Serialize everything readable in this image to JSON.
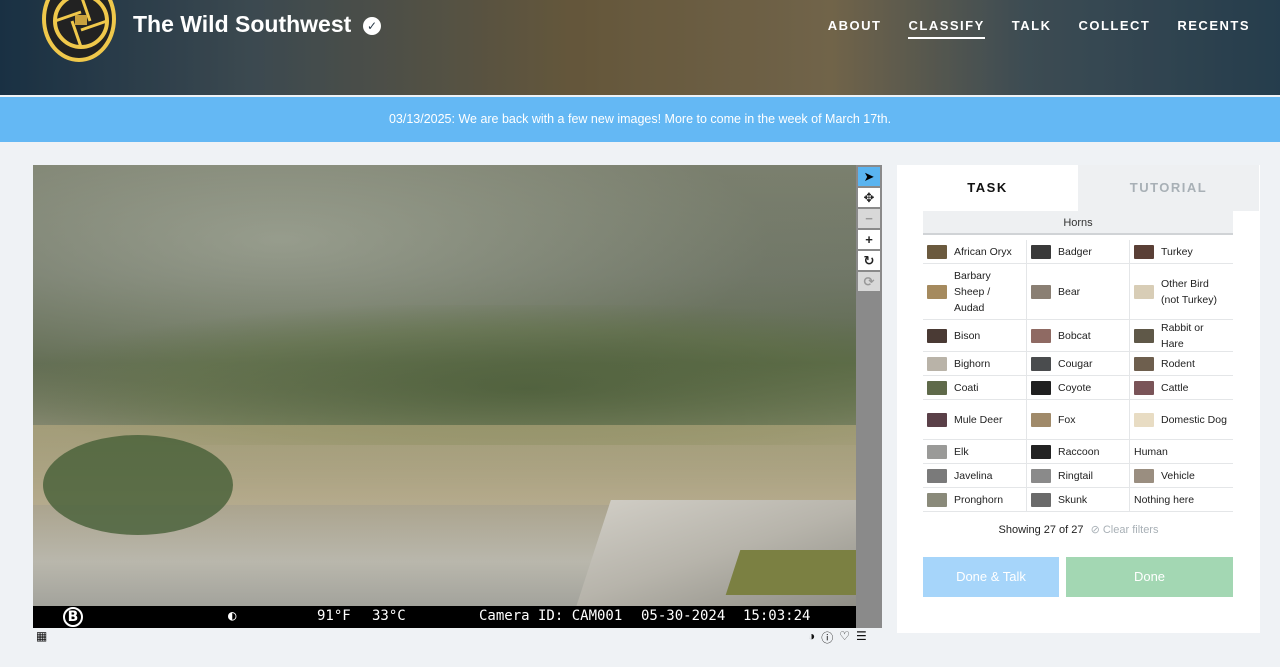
{
  "header": {
    "title": "The Wild Southwest",
    "nav": [
      "ABOUT",
      "CLASSIFY",
      "TALK",
      "COLLECT",
      "RECENTS"
    ],
    "active_nav": "CLASSIFY"
  },
  "banner": "03/13/2025: We are back with a few new images! More to come in the week of March 17th.",
  "image_info": {
    "brand_mark": "B",
    "temp_f": "91°F",
    "temp_c": "33°C",
    "camera": "Camera ID: CAM001",
    "date": "05-30-2024",
    "time": "15:03:24"
  },
  "tabs": {
    "task": "TASK",
    "tutorial": "TUTORIAL"
  },
  "filter_label": "Horns",
  "choices": [
    [
      {
        "label": "African Oryx",
        "color": "#6b5a3e"
      },
      {
        "label": "Badger",
        "color": "#3a3a3a"
      },
      {
        "label": "Turkey",
        "color": "#5a3f36"
      }
    ],
    [
      {
        "label": "Barbary Sheep / Audad",
        "color": "#a58a5e"
      },
      {
        "label": "Bear",
        "color": "#8a7f73"
      },
      {
        "label": "Other Bird (not Turkey)",
        "color": "#d8cdb6"
      }
    ],
    [
      {
        "label": "Bison",
        "color": "#4a3a34"
      },
      {
        "label": "Bobcat",
        "color": "#8f6a63"
      },
      {
        "label": "Rabbit or Hare",
        "color": "#5f5848"
      }
    ],
    [
      {
        "label": "Bighorn",
        "color": "#b9b3a8"
      },
      {
        "label": "Cougar",
        "color": "#4a4c4e"
      },
      {
        "label": "Rodent",
        "color": "#6e5f4e"
      }
    ],
    [
      {
        "label": "Coati",
        "color": "#5f6a4a"
      },
      {
        "label": "Coyote",
        "color": "#1f1f1f"
      },
      {
        "label": "Cattle",
        "color": "#7a5458"
      }
    ],
    [
      {
        "label": "Mule Deer",
        "color": "#5a4048"
      },
      {
        "label": "Fox",
        "color": "#a08a6a"
      },
      {
        "label": "Domestic Dog",
        "color": "#e8dcc3"
      }
    ],
    [
      {
        "label": "Elk",
        "color": "#9a9a98"
      },
      {
        "label": "Raccoon",
        "color": "#222222"
      },
      {
        "label": "Human",
        "color": ""
      }
    ],
    [
      {
        "label": "Javelina",
        "color": "#7a7a7a"
      },
      {
        "label": "Ringtail",
        "color": "#8a8a8a"
      },
      {
        "label": "Vehicle",
        "color": "#9a8e80"
      }
    ],
    [
      {
        "label": "Pronghorn",
        "color": "#8a8a7a"
      },
      {
        "label": "Skunk",
        "color": "#6a6a6a"
      },
      {
        "label": "Nothing here",
        "color": ""
      }
    ]
  ],
  "showing": "Showing 27 of 27",
  "clear_filters": "⊘ Clear filters",
  "buttons": {
    "done_talk": "Done & Talk",
    "done": "Done"
  },
  "colors": {
    "banner": "#64b8f4",
    "done_talk": "#a6d5fa",
    "done": "#a3d7b3",
    "logo_ring": "#f0c84b"
  }
}
